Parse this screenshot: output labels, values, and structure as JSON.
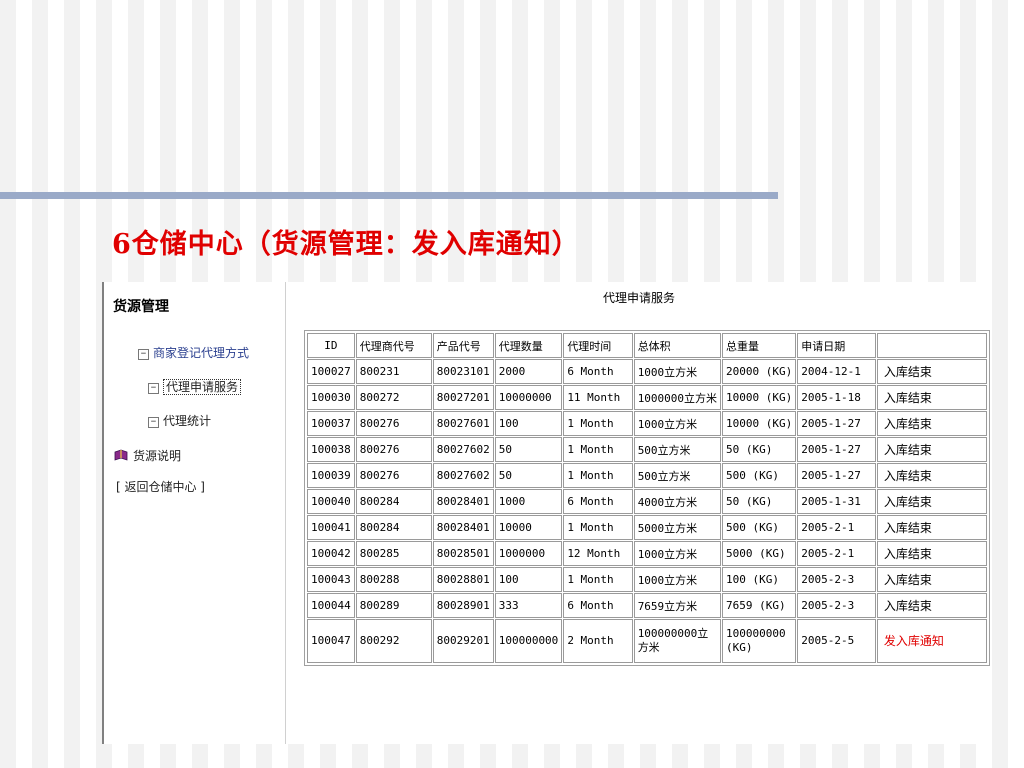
{
  "slide": {
    "title": "6仓储中心（货源管理：发入库通知）",
    "accent_color": "#e00000",
    "bar_color": "#9aaac8"
  },
  "sidebar": {
    "heading": "货源管理",
    "items": [
      {
        "label": "商家登记代理方式",
        "toggle": "−"
      },
      {
        "label": "代理申请服务",
        "toggle": "−"
      },
      {
        "label": "代理统计",
        "toggle": "−"
      },
      {
        "label": "货源说明",
        "icon": "book-icon"
      },
      {
        "label": "[ 返回仓储中心 ]"
      }
    ]
  },
  "main": {
    "title": "代理申请服务",
    "table": {
      "headers": [
        "ID",
        "代理商代号",
        "产品代号",
        "代理数量",
        "代理时间",
        "总体积",
        "总重量",
        "申请日期",
        ""
      ],
      "rows": [
        [
          "100027",
          "800231",
          "80023101",
          "2000",
          "6 Month",
          "1000立方米",
          "20000 (KG)",
          "2004-12-1",
          "入库结束"
        ],
        [
          "100030",
          "800272",
          "80027201",
          "10000000",
          "11 Month",
          "1000000立方米",
          "10000 (KG)",
          "2005-1-18",
          "入库结束"
        ],
        [
          "100037",
          "800276",
          "80027601",
          "100",
          "1 Month",
          "1000立方米",
          "10000 (KG)",
          "2005-1-27",
          "入库结束"
        ],
        [
          "100038",
          "800276",
          "80027602",
          "50",
          "1 Month",
          "500立方米",
          "50 (KG)",
          "2005-1-27",
          "入库结束"
        ],
        [
          "100039",
          "800276",
          "80027602",
          "50",
          "1 Month",
          "500立方米",
          "500 (KG)",
          "2005-1-27",
          "入库结束"
        ],
        [
          "100040",
          "800284",
          "80028401",
          "1000",
          "6 Month",
          "4000立方米",
          "50 (KG)",
          "2005-1-31",
          "入库结束"
        ],
        [
          "100041",
          "800284",
          "80028401",
          "10000",
          "1 Month",
          "5000立方米",
          "500 (KG)",
          "2005-2-1",
          "入库结束"
        ],
        [
          "100042",
          "800285",
          "80028501",
          "1000000",
          "12 Month",
          "1000立方米",
          "5000 (KG)",
          "2005-2-1",
          "入库结束"
        ],
        [
          "100043",
          "800288",
          "80028801",
          "100",
          "1 Month",
          "1000立方米",
          "100 (KG)",
          "2005-2-3",
          "入库结束"
        ],
        [
          "100044",
          "800289",
          "80028901",
          "333",
          "6 Month",
          "7659立方米",
          "7659 (KG)",
          "2005-2-3",
          "入库结束"
        ],
        [
          "100047",
          "800292",
          "80029201",
          "100000000",
          "2 Month",
          "100000000立方米",
          "100000000 (KG)",
          "2005-2-5",
          "发入库通知"
        ]
      ]
    }
  }
}
